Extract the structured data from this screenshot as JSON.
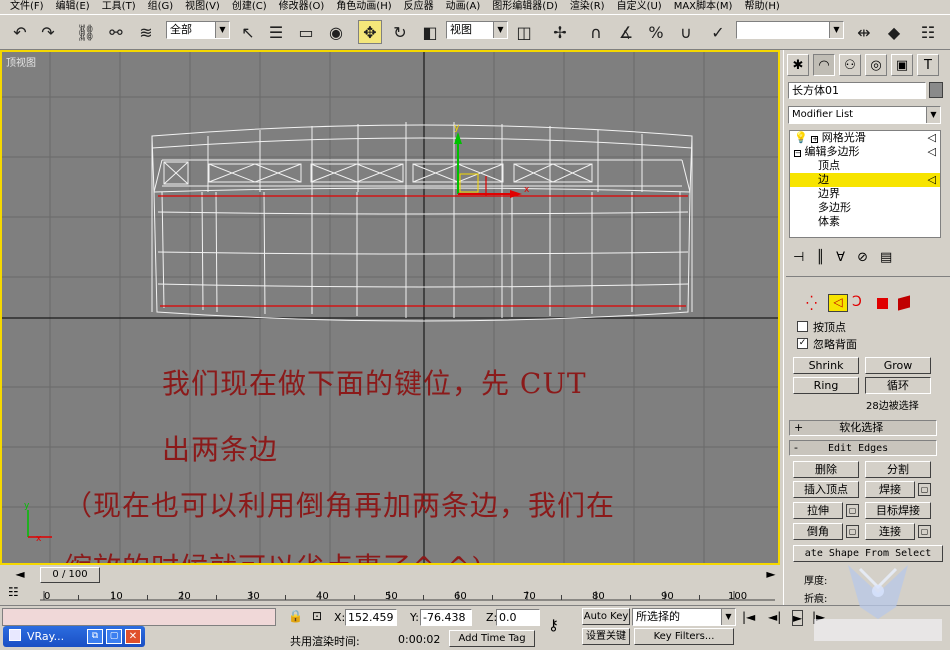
{
  "menu": [
    "文件(F)",
    "编辑(E)",
    "工具(T)",
    "组(G)",
    "视图(V)",
    "创建(C)",
    "修改器(O)",
    "角色动画(H)",
    "反应器",
    "动画(A)",
    "图形编辑器(D)",
    "渲染(R)",
    "自定义(U)",
    "MAX脚本(M)",
    "帮助(H)"
  ],
  "toolbar": {
    "selection_filter": "全部",
    "coord_system": "视图",
    "named_selection": ""
  },
  "viewport": {
    "label": "顶视图",
    "axis_x": "x",
    "axis_y": "y",
    "notes": [
      "我们现在做下面的键位，先 CUT",
      "出两条边",
      "（现在也可以利用倒角再加两条边，我们在",
      "缩放的时候就可以省点事了^-^)"
    ]
  },
  "panel": {
    "object_name": "长方体01",
    "modifier_list": "Modifier List",
    "stack": [
      {
        "label": "网格光滑",
        "level": 0
      },
      {
        "label": "编辑多边形",
        "level": 0
      },
      {
        "label": "顶点",
        "level": 1
      },
      {
        "label": "边",
        "level": 1,
        "selected": true
      },
      {
        "label": "边界",
        "level": 1
      },
      {
        "label": "多边形",
        "level": 1
      },
      {
        "label": "体素",
        "level": 1
      }
    ],
    "by_vertex": "按顶点",
    "ignore_backfacing": "忽略背面",
    "shrink": "Shrink",
    "grow": "Grow",
    "ring": "Ring",
    "loop": "循环",
    "selection_status": "28边被选择",
    "soft_selection": "软化选择",
    "edit_edges": "Edit Edges",
    "remove": "删除",
    "split": "分割",
    "insert_vertex": "插入顶点",
    "weld": "焊接",
    "extrude": "拉伸",
    "target_weld": "目标焊接",
    "chamfer": "倒角",
    "connect": "连接",
    "create_shape": "ate Shape From Select",
    "weight_label": "厚度:",
    "crease_label": "折痕:"
  },
  "timeline": {
    "frame": "0 / 100",
    "ticks": [
      "0",
      "10",
      "20",
      "30",
      "40",
      "50",
      "60",
      "70",
      "80",
      "90",
      "100"
    ]
  },
  "status": {
    "x_label": "X:",
    "x_value": "152.459",
    "y_label": "Y:",
    "y_value": "-76.438",
    "z_label": "Z:",
    "z_value": "0.0",
    "auto_key": "Auto Key",
    "selected": "所选择的",
    "set_key": "设置关键",
    "key_filters": "Key Filters...",
    "render_time_label": "共用渲染时间:",
    "render_time": "0:00:02",
    "add_time_tag": "Add Time Tag"
  },
  "taskbar": {
    "label": "VRay..."
  },
  "colors": {
    "viewport_bg": "#7f7f7f",
    "active_border": "#f5d800",
    "selection_red": "#e00000",
    "note_text": "#8b1a1a"
  }
}
